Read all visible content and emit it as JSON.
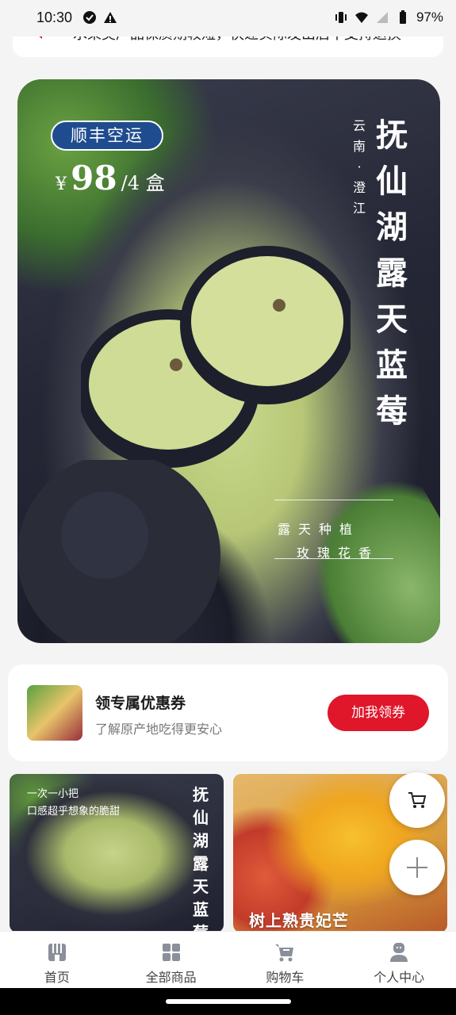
{
  "status_bar": {
    "time": "10:30",
    "battery": "97%"
  },
  "notice": {
    "text": "水果类产品保质期较短，快递实际发出后不支持退换"
  },
  "hero": {
    "badge": "顺丰空运",
    "price_symbol": "¥",
    "price_value": "98",
    "price_unit": "/4 盒",
    "title_chars": [
      "抚",
      "仙",
      "湖",
      "露",
      "天",
      "蓝",
      "莓"
    ],
    "origin_chars": [
      "云",
      "南",
      "·",
      "澄",
      "江"
    ],
    "tag_line1": "露天种植",
    "tag_line2": "玫瑰花香"
  },
  "coupon": {
    "title": "领专属优惠券",
    "subtitle": "了解原产地吃得更安心",
    "button": "加我领券"
  },
  "tiles": {
    "left_line1": "一次一小把",
    "left_line2": "口感超乎想象的脆甜",
    "left_title_chars": [
      "抚",
      "仙",
      "湖",
      "露",
      "天",
      "蓝",
      "莓"
    ],
    "right_title": "树上熟贵妃芒"
  },
  "nav": {
    "items": [
      {
        "label": "首页",
        "icon": "shop-icon"
      },
      {
        "label": "全部商品",
        "icon": "grid-icon"
      },
      {
        "label": "购物车",
        "icon": "cart-icon"
      },
      {
        "label": "个人中心",
        "icon": "user-icon"
      }
    ]
  },
  "colors": {
    "accent": "#e0162b",
    "badge_blue": "#1f4c8f",
    "nav_icon": "#8a8f99"
  }
}
